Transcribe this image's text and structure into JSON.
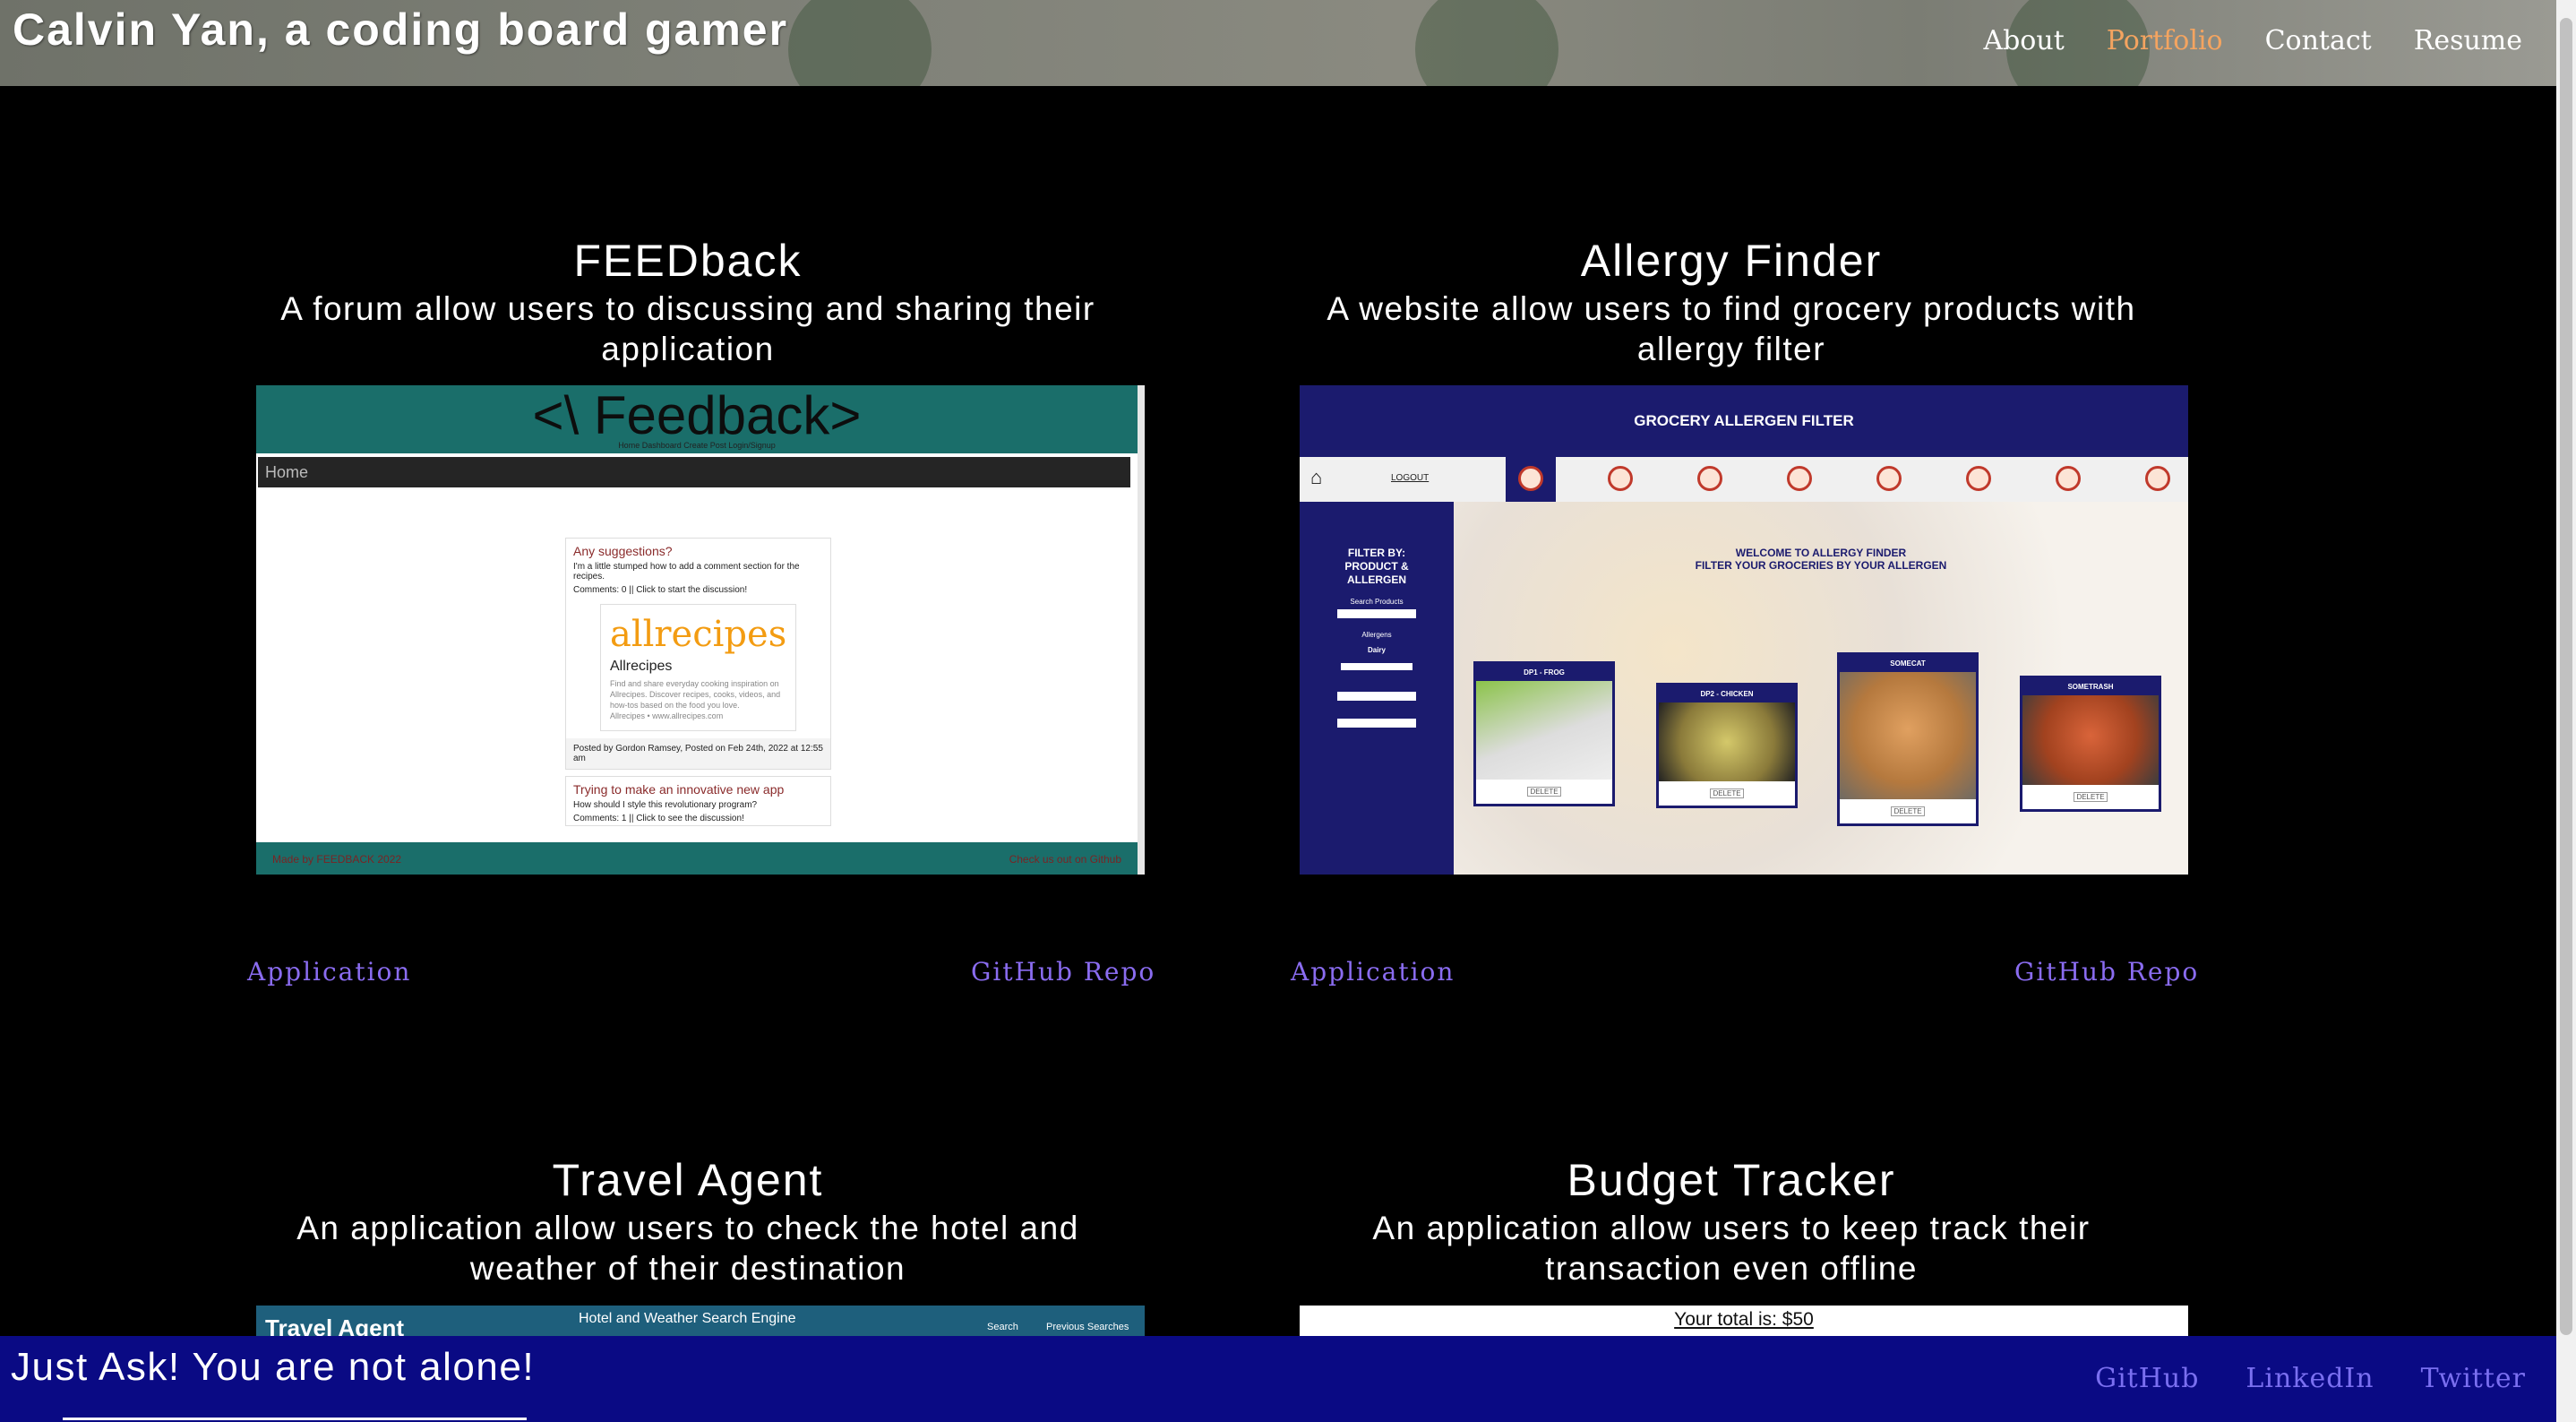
{
  "header": {
    "title": "Calvin Yan, a coding board gamer",
    "nav": [
      {
        "label": "About",
        "active": false
      },
      {
        "label": "Portfolio",
        "active": true
      },
      {
        "label": "Contact",
        "active": false
      },
      {
        "label": "Resume",
        "active": false
      }
    ]
  },
  "projects": [
    {
      "title": "FEEDback",
      "description": "A forum allow users to discussing and sharing their application",
      "app_link": "Application",
      "repo_link": "GitHub Repo",
      "screenshot": {
        "logo": "<\\ Feedback>",
        "nav_mini": "Home    Dashboard    Create Post    Login/Signup",
        "bar": "Home",
        "post1_title": "Any suggestions?",
        "post1_body": "I'm a little stumped how to add a comment section for the recipes.",
        "post1_comments": "Comments: 0 || Click to start the discussion!",
        "embed_brand": "allrecipes",
        "embed_name": "Allrecipes",
        "embed_text": "Find and share everyday cooking inspiration on Allrecipes. Discover recipes, cooks, videos, and how-tos based on the food you love.",
        "embed_url": "Allrecipes • www.allrecipes.com",
        "post1_meta": "Posted by Gordon Ramsey, Posted on Feb 24th, 2022 at 12:55 am",
        "post2_title": "Trying to make an innovative new app",
        "post2_body": "How should I style this revolutionary program?",
        "post2_comments": "Comments: 1 || Click to see the discussion!",
        "footer_left": "Made by FEEDBACK 2022",
        "footer_right": "Check us out on Github"
      }
    },
    {
      "title": "Allergy Finder",
      "description": "A website allow users to find grocery products with allergy filter",
      "app_link": "Application",
      "repo_link": "GitHub Repo",
      "screenshot": {
        "banner": "GROCERY ALLERGEN FILTER",
        "logout": "LOGOUT",
        "filter_by": "FILTER BY: PRODUCT & ALLERGEN",
        "search_products": "Search Products",
        "allergens": "Allergens",
        "dairy": "Dairy",
        "welcome1": "WELCOME TO ALLERGY FINDER",
        "welcome2": "FILTER YOUR GROCERIES BY YOUR ALLERGEN",
        "cards": [
          {
            "name": "DP1 - FROG",
            "button": "DELETE"
          },
          {
            "name": "DP2 - CHICKEN",
            "button": "DELETE"
          },
          {
            "name": "SOMECAT",
            "button": "DELETE"
          },
          {
            "name": "SOMETRASH",
            "button": "DELETE"
          }
        ]
      }
    },
    {
      "title": "Travel Agent",
      "description": "An application allow users to check the hotel and weather of their destination",
      "screenshot": {
        "brand": "Travel Agent",
        "center": "Hotel and Weather Search Engine",
        "search": "Search",
        "previous": "Previous Searches"
      }
    },
    {
      "title": "Budget Tracker",
      "description": "An application allow users to keep track their transaction even offline",
      "screenshot": {
        "total": "Your total is: $50"
      }
    }
  ],
  "footer": {
    "slogan": "Just Ask! You are not alone!",
    "social": [
      "GitHub",
      "LinkedIn",
      "Twitter"
    ]
  },
  "colors": {
    "background": "#000000",
    "nav_active": "#f4a460",
    "link": "#8a6cf0",
    "footer": "#0a0a84"
  }
}
